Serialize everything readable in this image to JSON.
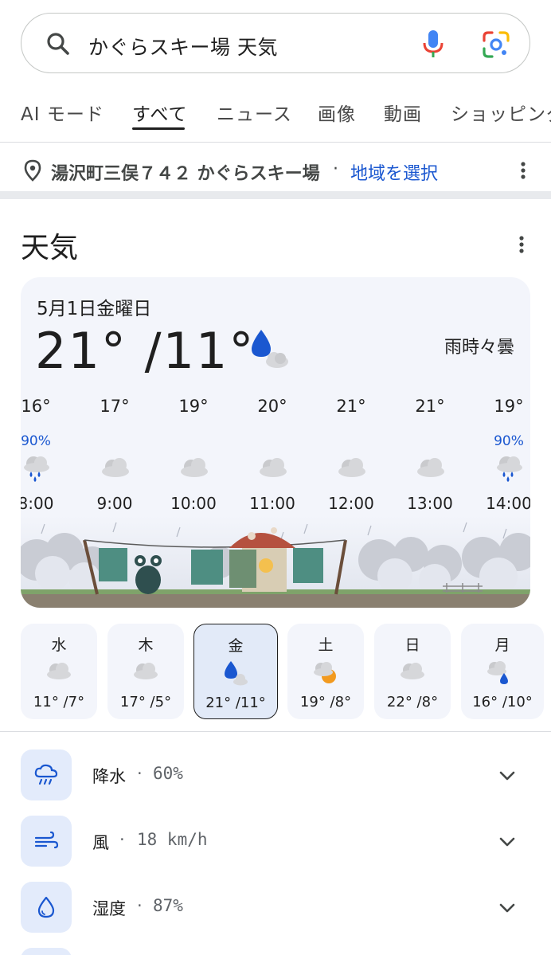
{
  "search": {
    "query": "かぐらスキー場 天気"
  },
  "tabs": [
    {
      "label": "AI モード"
    },
    {
      "label": "すべて",
      "active": true
    },
    {
      "label": "ニュース"
    },
    {
      "label": "画像"
    },
    {
      "label": "動画"
    },
    {
      "label": "ショッピング"
    }
  ],
  "location": {
    "place": "湯沢町三俣７４２ かぐらスキー場",
    "separator": "·",
    "select_link": "地域を選択"
  },
  "weather": {
    "section_title": "天気",
    "date": "5月1日金曜日",
    "temp_range": "21° /11°",
    "condition": "雨時々曇",
    "condition_icon": "rain-drop-cloud-icon",
    "hourly": [
      {
        "temp": "16°",
        "precip": "90%",
        "icon": "rain-cloud-icon",
        "time": "8:00"
      },
      {
        "temp": "17°",
        "precip": "",
        "icon": "cloud-icon",
        "time": "9:00"
      },
      {
        "temp": "19°",
        "precip": "",
        "icon": "cloud-icon",
        "time": "10:00"
      },
      {
        "temp": "20°",
        "precip": "",
        "icon": "cloud-icon",
        "time": "11:00"
      },
      {
        "temp": "21°",
        "precip": "",
        "icon": "cloud-icon",
        "time": "12:00"
      },
      {
        "temp": "21°",
        "precip": "",
        "icon": "cloud-icon",
        "time": "13:00"
      },
      {
        "temp": "19°",
        "precip": "90%",
        "icon": "rain-cloud-icon",
        "time": "14:00"
      }
    ],
    "days": [
      {
        "name": "水",
        "range": "11° /7°",
        "icon": "cloud-icon"
      },
      {
        "name": "木",
        "range": "17° /5°",
        "icon": "cloud-icon"
      },
      {
        "name": "金",
        "range": "21° /11°",
        "icon": "rain-drop-cloud-icon",
        "selected": true
      },
      {
        "name": "土",
        "range": "19° /8°",
        "icon": "sun-cloud-icon"
      },
      {
        "name": "日",
        "range": "22° /8°",
        "icon": "cloud-icon"
      },
      {
        "name": "月",
        "range": "16° /10°",
        "icon": "cloud-drop-icon"
      }
    ],
    "details": [
      {
        "label": "降水",
        "value": "60%",
        "icon": "precipitation-icon"
      },
      {
        "label": "風",
        "value": "18 km/h",
        "icon": "wind-icon"
      },
      {
        "label": "湿度",
        "value": "87%",
        "icon": "humidity-icon"
      }
    ],
    "detail_separator": "·"
  },
  "colors": {
    "accent_blue": "#1a57d0",
    "card_bg": "#f3f5fb",
    "icon_box_bg": "#e3ebfb"
  }
}
